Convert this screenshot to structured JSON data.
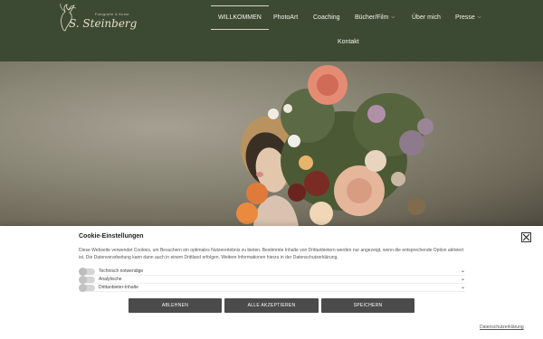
{
  "brand": {
    "logo_small": "Fotografie & Kunst",
    "logo_script": "S. Steinberg"
  },
  "nav": {
    "items": [
      {
        "label": "WILLKOMMEN"
      },
      {
        "label": "PhotoArt"
      },
      {
        "label": "Coaching"
      },
      {
        "label": "Bücher/Film"
      },
      {
        "label": "Über mich"
      },
      {
        "label": "Presse"
      },
      {
        "label": "Kontakt"
      }
    ]
  },
  "cookie": {
    "title": "Cookie-Einstellungen",
    "text": "Diese Webseite verwendet Cookies, um Besuchern ein optimales Nutzererlebnis zu bieten. Bestimmte Inhalte von Drittanbietern werden nur angezeigt, wenn die entsprechende Option aktiviert ist. Die Datenverarbeitung kann dann auch in einem Drittland erfolgen. Weitere Informationen hierzu in der Datenschutzerklärung.",
    "options": [
      {
        "label": "Technisch notwendige"
      },
      {
        "label": "Analytische"
      },
      {
        "label": "Drittanbieter-Inhalte"
      }
    ],
    "buttons": {
      "reject": "ABLEHNEN",
      "accept_all": "ALLE AKZEPTIEREN",
      "save": "SPEICHERN"
    },
    "privacy_link": "Datenschutzerklärung"
  },
  "colors": {
    "header_bg": "#3d4a33",
    "button_bg": "#4b4b4b"
  },
  "icons": {
    "logo": "deer-silhouette-icon",
    "close": "close-icon",
    "dropdown": "chevron-down-icon"
  }
}
